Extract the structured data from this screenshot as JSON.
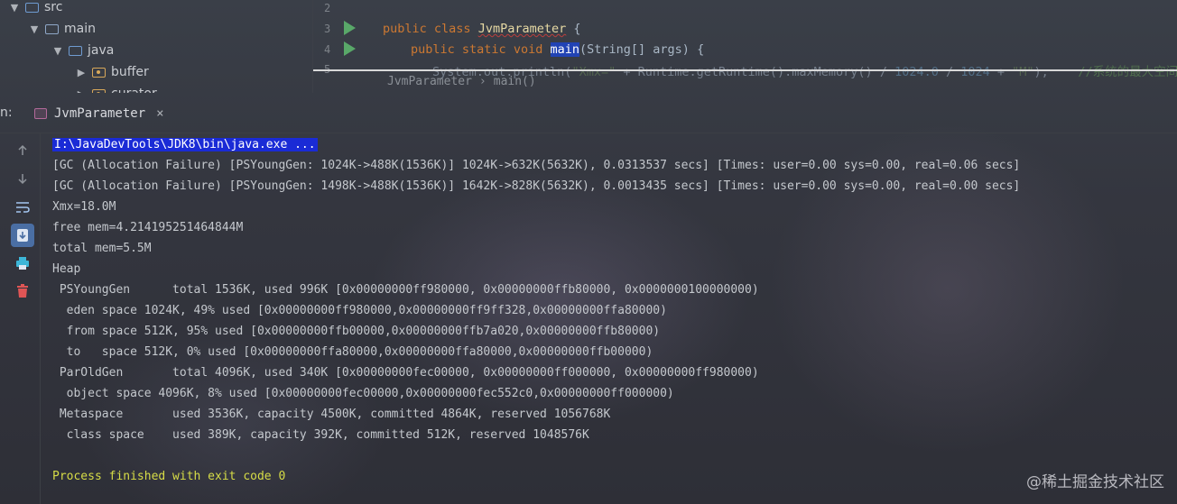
{
  "project_tree": {
    "items": [
      {
        "label": "src"
      },
      {
        "label": "main"
      },
      {
        "label": "java"
      },
      {
        "label": "buffer"
      },
      {
        "label": "curator"
      }
    ]
  },
  "editor": {
    "line_numbers": [
      "2",
      "3",
      "4",
      "5"
    ],
    "line3": {
      "kw1": "public",
      "kw2": "class",
      "class_name": "JvmParameter",
      "brace": "{"
    },
    "line4": {
      "kw1": "public",
      "kw2": "static",
      "kw3": "void",
      "method": "main",
      "params": "(String[] args)",
      "brace": "{"
    },
    "line5": {
      "code": "System.out.println(",
      "str1": "\"Xmx=\"",
      "mid": " + Runtime.getRuntime().maxMemory() / ",
      "num1": "1024.0",
      "div": " / ",
      "num2": "1024",
      "plus": " + ",
      "str2": "\"M\"",
      "end": ");",
      "comment": "//系统的最大空间"
    },
    "breadcrumb": {
      "class": "JvmParameter",
      "sep": "›",
      "method": "main()"
    }
  },
  "run_panel": {
    "label": "n:",
    "tab": {
      "label": "JvmParameter",
      "close": "×"
    },
    "tools": [
      "up-arrow-icon",
      "down-arrow-icon",
      "soft-wrap-icon",
      "scroll-to-end-icon",
      "print-icon",
      "trash-icon"
    ]
  },
  "console": {
    "command": "I:\\JavaDevTools\\JDK8\\bin\\java.exe ...",
    "lines": [
      "[GC (Allocation Failure) [PSYoungGen: 1024K->488K(1536K)] 1024K->632K(5632K), 0.0313537 secs] [Times: user=0.00 sys=0.00, real=0.06 secs]",
      "[GC (Allocation Failure) [PSYoungGen: 1498K->488K(1536K)] 1642K->828K(5632K), 0.0013435 secs] [Times: user=0.00 sys=0.00, real=0.00 secs]",
      "Xmx=18.0M",
      "free mem=4.214195251464844M",
      "total mem=5.5M",
      "Heap",
      " PSYoungGen      total 1536K, used 996K [0x00000000ff980000, 0x00000000ffb80000, 0x0000000100000000)",
      "  eden space 1024K, 49% used [0x00000000ff980000,0x00000000ff9ff328,0x00000000ffa80000)",
      "  from space 512K, 95% used [0x00000000ffb00000,0x00000000ffb7a020,0x00000000ffb80000)",
      "  to   space 512K, 0% used [0x00000000ffa80000,0x00000000ffa80000,0x00000000ffb00000)",
      " ParOldGen       total 4096K, used 340K [0x00000000fec00000, 0x00000000ff000000, 0x00000000ff980000)",
      "  object space 4096K, 8% used [0x00000000fec00000,0x00000000fec552c0,0x00000000ff000000)",
      " Metaspace       used 3536K, capacity 4500K, committed 4864K, reserved 1056768K",
      "  class space    used 389K, capacity 392K, committed 512K, reserved 1048576K",
      "",
      "Process finished with exit code 0"
    ]
  },
  "watermark": "@稀土掘金技术社区",
  "colors": {
    "command_bg": "#1a2bd6",
    "exit_text": "#d7dd47",
    "keyword": "#cc7832",
    "run_icon": "#59a869"
  }
}
